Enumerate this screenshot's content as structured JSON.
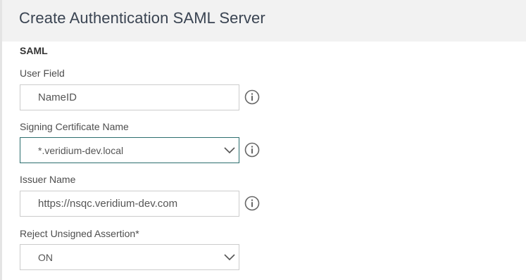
{
  "header": {
    "title": "Create Authentication SAML Server"
  },
  "section": {
    "title": "SAML"
  },
  "fields": {
    "user_field": {
      "label": "User Field",
      "value": "NameID"
    },
    "signing_cert": {
      "label": "Signing Certificate Name",
      "value": "*.veridium-dev.local"
    },
    "issuer_name": {
      "label": "Issuer Name",
      "value": "https://nsqc.veridium-dev.com"
    },
    "reject_unsigned": {
      "label": "Reject Unsigned Assertion*",
      "value": "ON"
    }
  },
  "icons": {
    "info": "info-icon",
    "dropdown": "chevron-down-icon"
  },
  "colors": {
    "header_bg": "#f2f2f2",
    "focus_border": "#2c6e6e",
    "field_border": "#cccccc"
  }
}
